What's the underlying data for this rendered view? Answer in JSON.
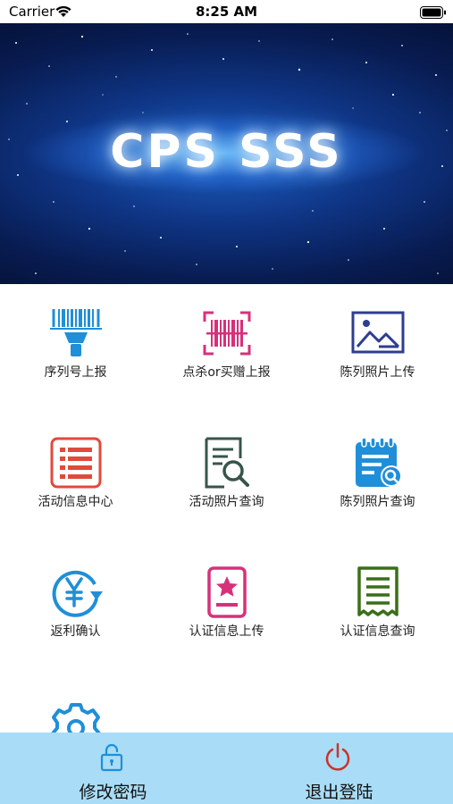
{
  "status_bar": {
    "carrier": "Carrier",
    "time": "8:25 AM"
  },
  "banner": {
    "title": "CPS SSS"
  },
  "menu": {
    "items": [
      {
        "label": "序列号上报",
        "icon": "barcode-scanner-icon"
      },
      {
        "label": "点杀or买赠上报",
        "icon": "barcode-scan-frame-icon"
      },
      {
        "label": "陈列照片上传",
        "icon": "image-icon"
      },
      {
        "label": "活动信息中心",
        "icon": "document-list-icon"
      },
      {
        "label": "活动照片查询",
        "icon": "document-search-icon"
      },
      {
        "label": "陈列照片查询",
        "icon": "calendar-search-icon"
      },
      {
        "label": "返利确认",
        "icon": "yuan-refresh-icon"
      },
      {
        "label": "认证信息上传",
        "icon": "certificate-star-icon"
      },
      {
        "label": "认证信息查询",
        "icon": "receipt-icon"
      },
      {
        "label": "",
        "icon": "gear-icon"
      }
    ]
  },
  "bottom": {
    "change_password": "修改密码",
    "logout": "退出登陆"
  },
  "colors": {
    "blue": "#1f8fd9",
    "magenta": "#d6317a",
    "navy": "#2d3e8f",
    "red": "#e04a3c",
    "dark_green": "#37554a",
    "green": "#3a6f16",
    "bottom_bar": "#a9dcf6",
    "logout_red": "#c8342c"
  }
}
